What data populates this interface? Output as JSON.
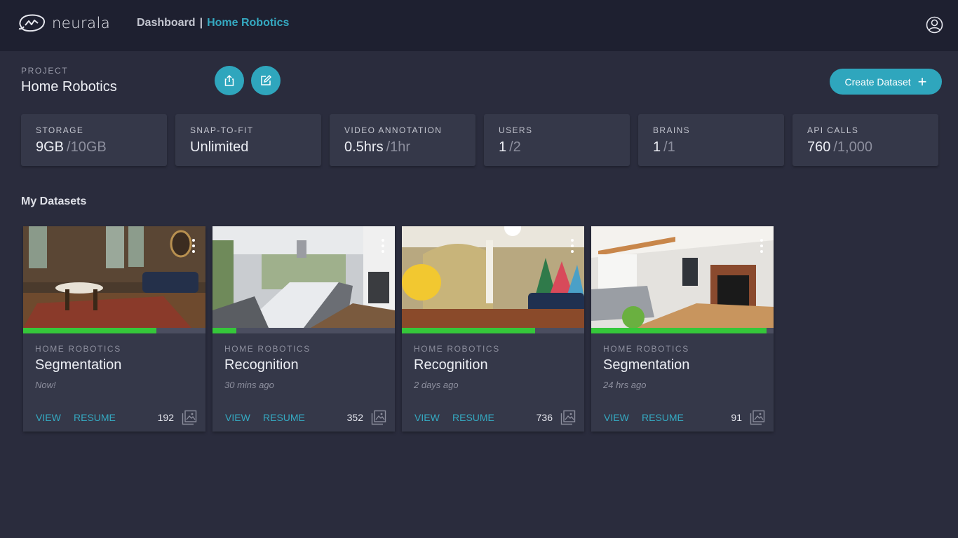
{
  "header": {
    "logo_text": "neurala",
    "breadcrumb": {
      "root": "Dashboard",
      "separator": "|",
      "current": "Home Robotics"
    }
  },
  "project": {
    "label": "PROJECT",
    "name": "Home Robotics",
    "create_button_label": "Create Dataset"
  },
  "stats": [
    {
      "label": "STORAGE",
      "value": "9GB",
      "limit": "/10GB"
    },
    {
      "label": "SNAP-TO-FIT",
      "value": "Unlimited",
      "limit": ""
    },
    {
      "label": "VIDEO ANNOTATION",
      "value": "0.5hrs",
      "limit": "/1hr"
    },
    {
      "label": "USERS",
      "value": "1",
      "limit": "/2"
    },
    {
      "label": "BRAINS",
      "value": "1",
      "limit": "/1"
    },
    {
      "label": "API CALLS",
      "value": "760",
      "limit": "/1,000"
    }
  ],
  "datasets_section_title": "My Datasets",
  "datasets": [
    {
      "project": "HOME ROBOTICS",
      "title": "Segmentation",
      "time": "Now!",
      "view_label": "VIEW",
      "resume_label": "RESUME",
      "count": "192",
      "progress_percent": 73
    },
    {
      "project": "HOME ROBOTICS",
      "title": "Recognition",
      "time": "30 mins ago",
      "view_label": "VIEW",
      "resume_label": "RESUME",
      "count": "352",
      "progress_percent": 13
    },
    {
      "project": "HOME ROBOTICS",
      "title": "Recognition",
      "time": "2 days ago",
      "view_label": "VIEW",
      "resume_label": "RESUME",
      "count": "736",
      "progress_percent": 73
    },
    {
      "project": "HOME ROBOTICS",
      "title": "Segmentation",
      "time": "24 hrs ago",
      "view_label": "VIEW",
      "resume_label": "RESUME",
      "count": "91",
      "progress_percent": 96
    }
  ],
  "colors": {
    "accent": "#2fa6bd",
    "progress": "#35c73a",
    "background": "#2a2c3d",
    "topbar": "#1e2030",
    "card": "#353849"
  },
  "icons": {
    "user": "user-circle-icon",
    "share": "share-icon",
    "edit": "edit-icon",
    "more": "more-vertical-icon",
    "gallery": "image-gallery-icon",
    "plus": "plus-icon"
  }
}
